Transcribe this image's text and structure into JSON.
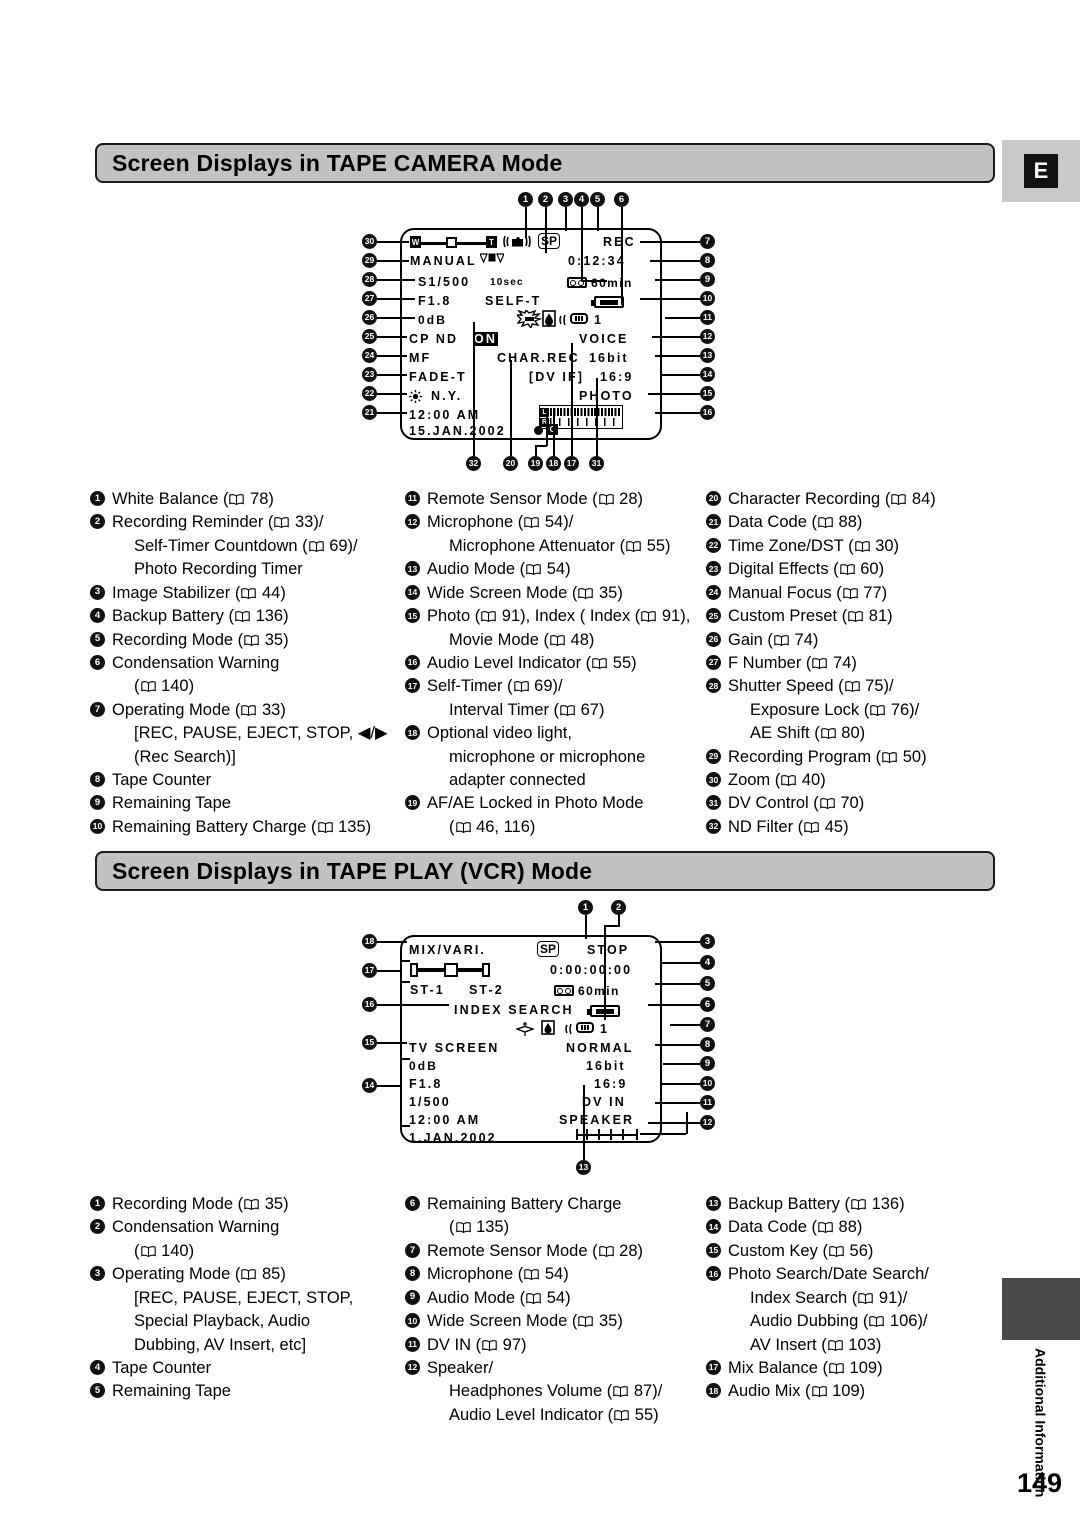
{
  "page": {
    "number": "149",
    "lang_badge": "E",
    "side_tab_label": "Additional Information"
  },
  "section1": {
    "title": "Screen Displays in TAPE CAMERA Mode",
    "lcd": {
      "zoom_w": "W",
      "zoom_t": "T",
      "sp": "SP",
      "rec": "REC",
      "manual": "MANUAL",
      "counter": "0:12:34",
      "shutter": "S1/500",
      "selftimer_sec": "10sec",
      "remaining_tape": "60min",
      "fnumber": "F1.8",
      "selft": "SELF-T",
      "gain": "0dB",
      "remote_num": "1",
      "cp_nd": "CP ND",
      "cp_nd_on": "ON",
      "voice": "VOICE",
      "mf": "MF",
      "char_rec": "CHAR.REC",
      "bit": "16bit",
      "fade": "FADE-T",
      "dvif": "[DV IF]",
      "wide": "16:9",
      "city": "N.Y.",
      "photo": "PHOTO",
      "time": "12:00 AM",
      "date": "15.JAN.2002",
      "meter_l": "L",
      "meter_r": "R"
    },
    "callouts_top": [
      "1",
      "2",
      "3",
      "4",
      "5",
      "6"
    ],
    "callouts_right": [
      "7",
      "8",
      "9",
      "10",
      "11",
      "12",
      "13",
      "14",
      "15",
      "16"
    ],
    "callouts_left": [
      "30",
      "29",
      "28",
      "27",
      "26",
      "25",
      "24",
      "23",
      "22",
      "21"
    ],
    "callouts_bottom": [
      "32",
      "20",
      "19",
      "18",
      "17",
      "31"
    ],
    "legend": [
      {
        "n": "1",
        "lines": [
          {
            "t": "White Balance (",
            "p": "78",
            "after": ")"
          }
        ]
      },
      {
        "n": "2",
        "lines": [
          {
            "t": "Recording Reminder (",
            "p": "33",
            "after": ")/"
          },
          {
            "t": "Self-Timer Countdown (",
            "p": "69",
            "after": ")/"
          },
          {
            "t": "Photo Recording Timer",
            "p": "",
            "after": ""
          }
        ]
      },
      {
        "n": "3",
        "lines": [
          {
            "t": "Image Stabilizer (",
            "p": "44",
            "after": ")"
          }
        ]
      },
      {
        "n": "4",
        "lines": [
          {
            "t": "Backup Battery (",
            "p": "136",
            "after": ")"
          }
        ]
      },
      {
        "n": "5",
        "lines": [
          {
            "t": "Recording Mode (",
            "p": "35",
            "after": ")"
          }
        ]
      },
      {
        "n": "6",
        "lines": [
          {
            "t": "Condensation Warning",
            "p": "",
            "after": ""
          },
          {
            "t": "(",
            "p": "140",
            "after": ")"
          }
        ]
      },
      {
        "n": "7",
        "lines": [
          {
            "t": "Operating Mode (",
            "p": "33",
            "after": ")"
          },
          {
            "t": "[REC, PAUSE, EJECT, STOP, ◀/▶",
            "p": "",
            "after": ""
          },
          {
            "t": "(Rec Search)]",
            "p": "",
            "after": ""
          }
        ]
      },
      {
        "n": "8",
        "lines": [
          {
            "t": "Tape Counter",
            "p": "",
            "after": ""
          }
        ]
      },
      {
        "n": "9",
        "lines": [
          {
            "t": "Remaining Tape",
            "p": "",
            "after": ""
          }
        ]
      },
      {
        "n": "10",
        "lines": [
          {
            "t": "Remaining Battery Charge (",
            "p": "135",
            "after": ")"
          }
        ]
      },
      {
        "n": "11",
        "lines": [
          {
            "t": "Remote Sensor Mode (",
            "p": "28",
            "after": ")"
          }
        ]
      },
      {
        "n": "12",
        "lines": [
          {
            "t": "Microphone (",
            "p": "54",
            "after": ")/"
          },
          {
            "t": "Microphone Attenuator (",
            "p": "55",
            "after": ")"
          }
        ]
      },
      {
        "n": "13",
        "lines": [
          {
            "t": "Audio Mode (",
            "p": "54",
            "after": ")"
          }
        ]
      },
      {
        "n": "14",
        "lines": [
          {
            "t": "Wide Screen Mode (",
            "p": "35",
            "after": ")"
          }
        ]
      },
      {
        "n": "15",
        "lines": [
          {
            "t": "Photo (",
            "p": "91",
            "after": "), Index (",
            "p2": "91",
            "after2": "),"
          },
          {
            "t": "Movie Mode (",
            "p": "48",
            "after": ")"
          }
        ]
      },
      {
        "n": "16",
        "lines": [
          {
            "t": "Audio Level Indicator (",
            "p": "55",
            "after": ")"
          }
        ]
      },
      {
        "n": "17",
        "lines": [
          {
            "t": "Self-Timer (",
            "p": "69",
            "after": ")/"
          },
          {
            "t": "Interval Timer (",
            "p": "67",
            "after": ")"
          }
        ]
      },
      {
        "n": "18",
        "lines": [
          {
            "t": "Optional video light,",
            "p": "",
            "after": ""
          },
          {
            "t": "microphone or microphone",
            "p": "",
            "after": ""
          },
          {
            "t": "adapter connected",
            "p": "",
            "after": ""
          }
        ]
      },
      {
        "n": "19",
        "lines": [
          {
            "t": "AF/AE Locked in Photo Mode",
            "p": "",
            "after": ""
          },
          {
            "t": "(",
            "p": "46, 116",
            "after": ")"
          }
        ]
      },
      {
        "n": "20",
        "lines": [
          {
            "t": "Character Recording (",
            "p": "84",
            "after": ")"
          }
        ]
      },
      {
        "n": "21",
        "lines": [
          {
            "t": "Data Code (",
            "p": "88",
            "after": ")"
          }
        ]
      },
      {
        "n": "22",
        "lines": [
          {
            "t": "Time Zone/DST (",
            "p": "30",
            "after": ")"
          }
        ]
      },
      {
        "n": "23",
        "lines": [
          {
            "t": "Digital Effects (",
            "p": "60",
            "after": ")"
          }
        ]
      },
      {
        "n": "24",
        "lines": [
          {
            "t": "Manual Focus (",
            "p": "77",
            "after": ")"
          }
        ]
      },
      {
        "n": "25",
        "lines": [
          {
            "t": "Custom Preset (",
            "p": "81",
            "after": ")"
          }
        ]
      },
      {
        "n": "26",
        "lines": [
          {
            "t": "Gain (",
            "p": "74",
            "after": ")"
          }
        ]
      },
      {
        "n": "27",
        "lines": [
          {
            "t": "F Number (",
            "p": "74",
            "after": ")"
          }
        ]
      },
      {
        "n": "28",
        "lines": [
          {
            "t": "Shutter Speed (",
            "p": "75",
            "after": ")/"
          },
          {
            "t": "Exposure Lock (",
            "p": "76",
            "after": ")/"
          },
          {
            "t": "AE Shift (",
            "p": "80",
            "after": ")"
          }
        ]
      },
      {
        "n": "29",
        "lines": [
          {
            "t": "Recording Program (",
            "p": "50",
            "after": ")"
          }
        ]
      },
      {
        "n": "30",
        "lines": [
          {
            "t": "Zoom (",
            "p": "40",
            "after": ")"
          }
        ]
      },
      {
        "n": "31",
        "lines": [
          {
            "t": "DV Control (",
            "p": "70",
            "after": ")"
          }
        ]
      },
      {
        "n": "32",
        "lines": [
          {
            "t": "ND Filter (",
            "p": "45",
            "after": ")"
          }
        ]
      }
    ]
  },
  "section2": {
    "title": "Screen Displays in TAPE PLAY (VCR) Mode",
    "lcd": {
      "mix": "MIX/VARI.",
      "sp": "SP",
      "stop": "STOP",
      "counter": "0:00:00:00",
      "st1": "ST-1",
      "st2": "ST-2",
      "remaining_tape": "60min",
      "index_search": "INDEX SEARCH",
      "remote_num": "1",
      "tv_screen": "TV SCREEN",
      "normal": "NORMAL",
      "gain": "0dB",
      "bit": "16bit",
      "fnumber": "F1.8",
      "wide": "16:9",
      "shutter": "1/500",
      "dv_in": "DV IN",
      "time": "12:00 AM",
      "speaker": "SPEAKER",
      "date": "1.JAN.2002"
    },
    "callouts_top": [
      "1",
      "2"
    ],
    "callouts_right": [
      "3",
      "4",
      "5",
      "6",
      "7",
      "8",
      "9",
      "10",
      "11",
      "12"
    ],
    "callouts_left": [
      "18",
      "17",
      "16",
      "15",
      "14"
    ],
    "callouts_bottom": [
      "13"
    ],
    "legend": [
      {
        "n": "1",
        "lines": [
          {
            "t": "Recording Mode (",
            "p": "35",
            "after": ")"
          }
        ]
      },
      {
        "n": "2",
        "lines": [
          {
            "t": "Condensation Warning",
            "p": "",
            "after": ""
          },
          {
            "t": "(",
            "p": "140",
            "after": ")"
          }
        ]
      },
      {
        "n": "3",
        "lines": [
          {
            "t": "Operating Mode (",
            "p": "85",
            "after": ")"
          },
          {
            "t": "[REC, PAUSE, EJECT, STOP,",
            "p": "",
            "after": ""
          },
          {
            "t": "Special Playback, Audio",
            "p": "",
            "after": ""
          },
          {
            "t": "Dubbing, AV Insert, etc]",
            "p": "",
            "after": ""
          }
        ]
      },
      {
        "n": "4",
        "lines": [
          {
            "t": "Tape Counter",
            "p": "",
            "after": ""
          }
        ]
      },
      {
        "n": "5",
        "lines": [
          {
            "t": "Remaining Tape",
            "p": "",
            "after": ""
          }
        ]
      },
      {
        "n": "6",
        "lines": [
          {
            "t": "Remaining Battery Charge",
            "p": "",
            "after": ""
          },
          {
            "t": "(",
            "p": "135",
            "after": ")"
          }
        ]
      },
      {
        "n": "7",
        "lines": [
          {
            "t": "Remote Sensor Mode (",
            "p": "28",
            "after": ")"
          }
        ]
      },
      {
        "n": "8",
        "lines": [
          {
            "t": "Microphone (",
            "p": "54",
            "after": ")"
          }
        ]
      },
      {
        "n": "9",
        "lines": [
          {
            "t": "Audio Mode (",
            "p": "54",
            "after": ")"
          }
        ]
      },
      {
        "n": "10",
        "lines": [
          {
            "t": "Wide Screen Mode (",
            "p": "35",
            "after": ")"
          }
        ]
      },
      {
        "n": "11",
        "lines": [
          {
            "t": "DV IN (",
            "p": "97",
            "after": ")"
          }
        ]
      },
      {
        "n": "12",
        "lines": [
          {
            "t": "Speaker/",
            "p": "",
            "after": ""
          },
          {
            "t": "Headphones Volume (",
            "p": "87",
            "after": ")/"
          },
          {
            "t": "Audio Level Indicator (",
            "p": "55",
            "after": ")"
          }
        ]
      },
      {
        "n": "13",
        "lines": [
          {
            "t": "Backup Battery (",
            "p": "136",
            "after": ")"
          }
        ]
      },
      {
        "n": "14",
        "lines": [
          {
            "t": "Data Code (",
            "p": "88",
            "after": ")"
          }
        ]
      },
      {
        "n": "15",
        "lines": [
          {
            "t": "Custom Key (",
            "p": "56",
            "after": ")"
          }
        ]
      },
      {
        "n": "16",
        "lines": [
          {
            "t": "Photo Search/Date Search/",
            "p": "",
            "after": ""
          },
          {
            "t": "Index Search (",
            "p": "91",
            "after": ")/"
          },
          {
            "t": "Audio Dubbing (",
            "p": "106",
            "after": ")/"
          },
          {
            "t": "AV Insert (",
            "p": "103",
            "after": ")"
          }
        ]
      },
      {
        "n": "17",
        "lines": [
          {
            "t": "Mix Balance (",
            "p": "109",
            "after": ")"
          }
        ]
      },
      {
        "n": "18",
        "lines": [
          {
            "t": "Audio Mix (",
            "p": "109",
            "after": ")"
          }
        ]
      }
    ]
  }
}
